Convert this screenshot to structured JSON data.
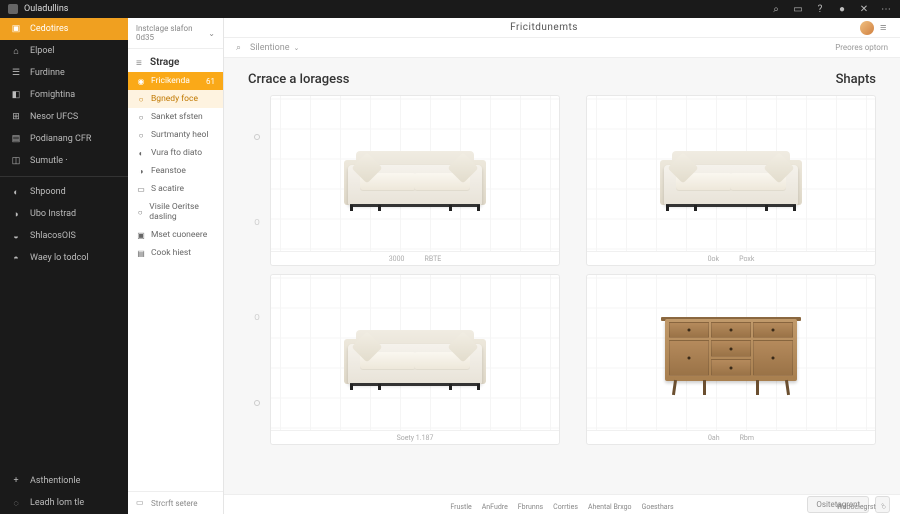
{
  "topbar": {
    "title": "Ouladullins",
    "icons": {
      "search": "⌕",
      "panel": "▭",
      "help": "?",
      "bell": "●",
      "close": "✕",
      "more": "⋯"
    }
  },
  "sidebarL": {
    "items": [
      {
        "label": "Cedotires",
        "icon": "▣",
        "active": true
      },
      {
        "label": "Elpoel",
        "icon": "⌂"
      },
      {
        "label": "Furdinne",
        "icon": "☰"
      },
      {
        "label": "Fomightina",
        "icon": "◧"
      },
      {
        "label": "Nesor UFCS",
        "icon": "⊞"
      },
      {
        "label": "Podianang CFR",
        "icon": "▤"
      },
      {
        "label": "Sumutle ·",
        "icon": "◫"
      }
    ],
    "group2": [
      {
        "label": "Shpoond",
        "icon": "◐"
      },
      {
        "label": "Ubo Instrad",
        "icon": "◑"
      },
      {
        "label": "ShlacosOIS",
        "icon": "◒"
      },
      {
        "label": "Waey lo todcol",
        "icon": "◓"
      }
    ],
    "bottom": [
      {
        "label": "Asthentionle",
        "icon": "+"
      },
      {
        "label": "Leadh lom tle",
        "icon": "◌"
      }
    ]
  },
  "sidebarM": {
    "header": "lnstclage slafon 0d35",
    "section": "Strage",
    "items": [
      {
        "label": "Fricikenda",
        "icon": "◉",
        "active": true,
        "badge": "61"
      },
      {
        "label": "Bgnedy foce",
        "icon": "○",
        "sub": true
      },
      {
        "label": "Sanket sfsten",
        "icon": "○"
      },
      {
        "label": "Surtmanty heol",
        "icon": "○"
      },
      {
        "label": "Vura fto diato",
        "icon": "◐"
      },
      {
        "label": "Feanstoe",
        "icon": "◑"
      },
      {
        "label": "S acatire",
        "icon": "▭"
      },
      {
        "label": "Visile Oeritse dasling",
        "icon": "○"
      },
      {
        "label": "Mset cuoneere",
        "icon": "▣"
      },
      {
        "label": "Cook hiest",
        "icon": "▤"
      }
    ],
    "footer": "Strcrft setere"
  },
  "main": {
    "header": {
      "title": "Fricitdunemts"
    },
    "sub": {
      "search": "Silentione",
      "options": "Preores optorn"
    },
    "content": {
      "title": "Crrace a loragess",
      "shapes": "Shapts"
    },
    "cards": [
      {
        "cap": [
          "3000",
          "RBTE"
        ]
      },
      {
        "cap": [
          "0ok",
          "Poxk"
        ]
      },
      {
        "cap": [
          "Soety 1.187"
        ]
      },
      {
        "cap": [
          "0ah",
          "Rbm"
        ]
      }
    ],
    "bottombar": {
      "btn": "Ositetagrent",
      "sq": "◦"
    }
  },
  "footer": {
    "links": [
      "Frustle",
      "AnFudre",
      "Fbrunns",
      "Corrties",
      "Ahental Brxgo",
      "Goesthars"
    ],
    "right": [
      "Wdboclegrst",
      "○"
    ]
  }
}
